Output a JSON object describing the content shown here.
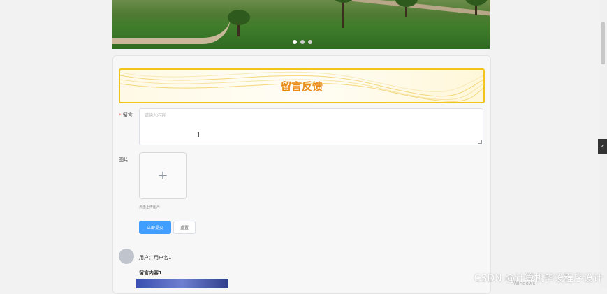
{
  "banner": {
    "dots": 3,
    "active_dot": 1
  },
  "feedback": {
    "title": "留言反馈",
    "message_label": "留言",
    "message_placeholder": "请输入内容",
    "image_label": "图片",
    "upload_hint": "点击上传图片",
    "submit_label": "立即提交",
    "reset_label": "重置"
  },
  "comment": {
    "user": "用户：用户名1",
    "content": "留言内容1"
  },
  "side_tab_icon": "chevron-left-icon",
  "watermark": "CSDN @计算机毕设程序设计",
  "colors": {
    "accent": "#409eff",
    "title": "#e98a16",
    "title_border": "#f0c419"
  }
}
